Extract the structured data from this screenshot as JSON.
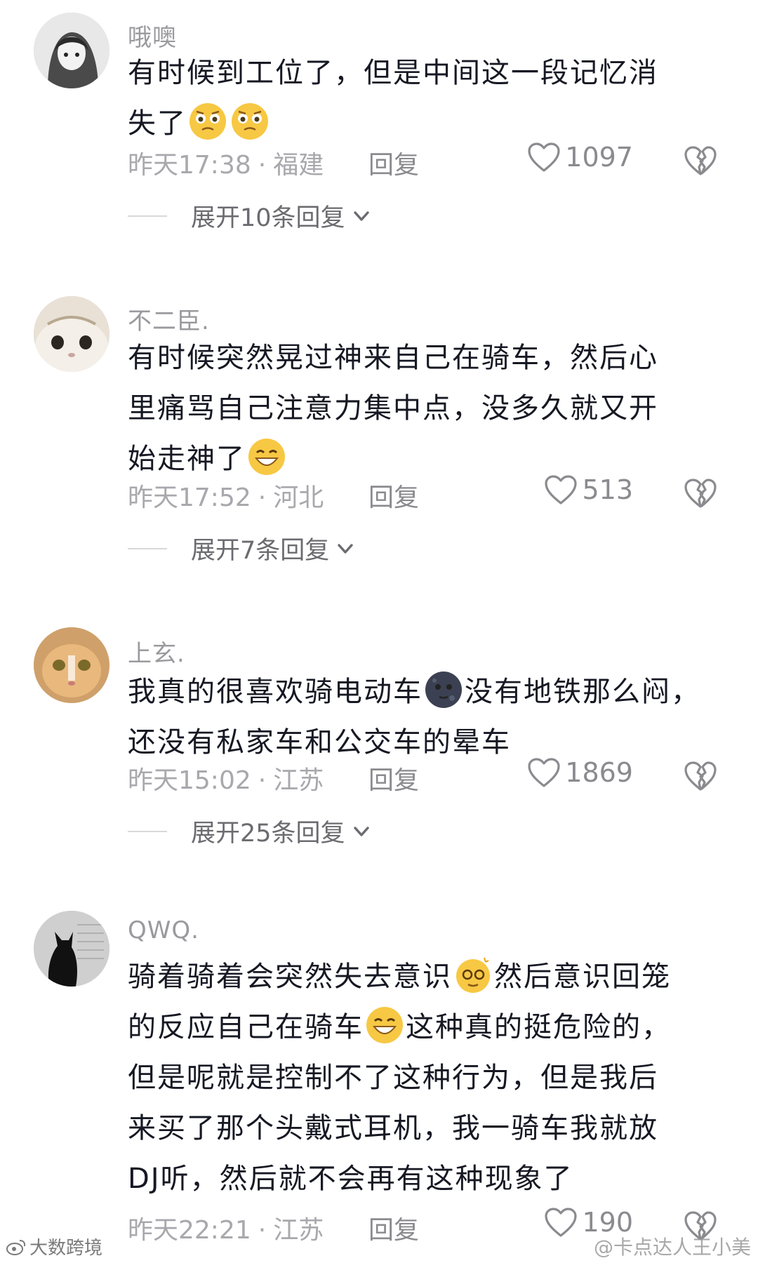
{
  "comments": [
    {
      "username": "哦噢",
      "lines": [
        "有时候到工位了，但是中间这一段记忆消",
        "失了"
      ],
      "emoji_count": 2,
      "time": "昨天17:38",
      "location": "福建",
      "reply_label": "回复",
      "likes": "1097",
      "expand_label": "展开10条回复"
    },
    {
      "username": "不二臣.",
      "lines": [
        "有时候突然晃过神来自己在骑车，然后心",
        "里痛骂自己注意力集中点，没多久就又开",
        "始走神了"
      ],
      "time": "昨天17:52",
      "location": "河北",
      "reply_label": "回复",
      "likes": "513",
      "expand_label": "展开7条回复"
    },
    {
      "username": "上玄.",
      "line1_a": "我真的很喜欢骑电动车",
      "line1_b": "没有地铁那么闷，",
      "line2": "还没有私家车和公交车的晕车",
      "time": "昨天15:02",
      "location": "江苏",
      "reply_label": "回复",
      "likes": "1869",
      "expand_label": "展开25条回复"
    },
    {
      "username": "QWQ.",
      "line1_a": "骑着骑着会突然失去意识",
      "line1_b": "然后意识回笼",
      "line2_a": "的反应自己在骑车",
      "line2_b": "这种真的挺危险的，",
      "line3": "但是呢就是控制不了这种行为，但是我后",
      "line4": "来买了那个头戴式耳机，我一骑车我就放",
      "line5": "DJ听，然后就不会再有这种现象了",
      "time": "昨天22:21",
      "location": "江苏",
      "reply_label": "回复",
      "likes": "190"
    }
  ],
  "separator": "·",
  "watermark_left": "大数跨境",
  "watermark_right": "@卡点达人王小美",
  "colors": {
    "text": "#161823",
    "meta": "#a8a8ad",
    "username": "#9a9a9e"
  },
  "icons": [
    "heart-outline-icon",
    "broken-heart-icon",
    "chevron-down-icon",
    "weibo-logo-icon"
  ]
}
